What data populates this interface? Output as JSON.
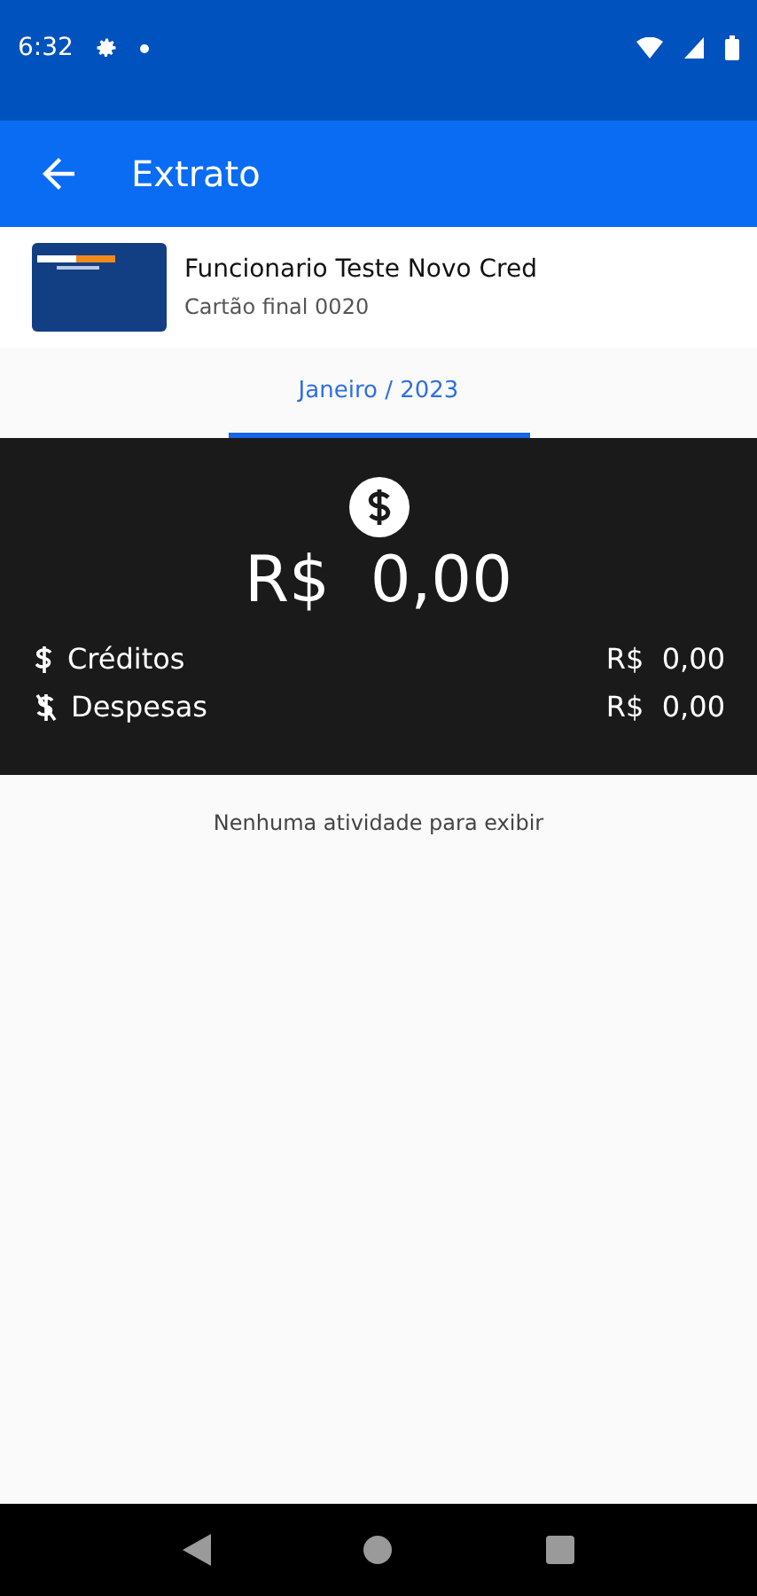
{
  "status_bar": {
    "time": "6:32"
  },
  "app_bar": {
    "title": "Extrato"
  },
  "account": {
    "name": "Funcionario Teste Novo Cred",
    "card": "Cartão final 0020"
  },
  "tabs": [
    {
      "label": "Janeiro / 2023",
      "selected": true
    }
  ],
  "summary": {
    "balance": "R$  0,00",
    "rows": [
      {
        "kind": "credit",
        "label": "Créditos",
        "amount": "R$  0,00"
      },
      {
        "kind": "debit",
        "label": "Despesas",
        "amount": "R$  0,00"
      }
    ]
  },
  "empty_message": "Nenhuma atividade para exibir"
}
